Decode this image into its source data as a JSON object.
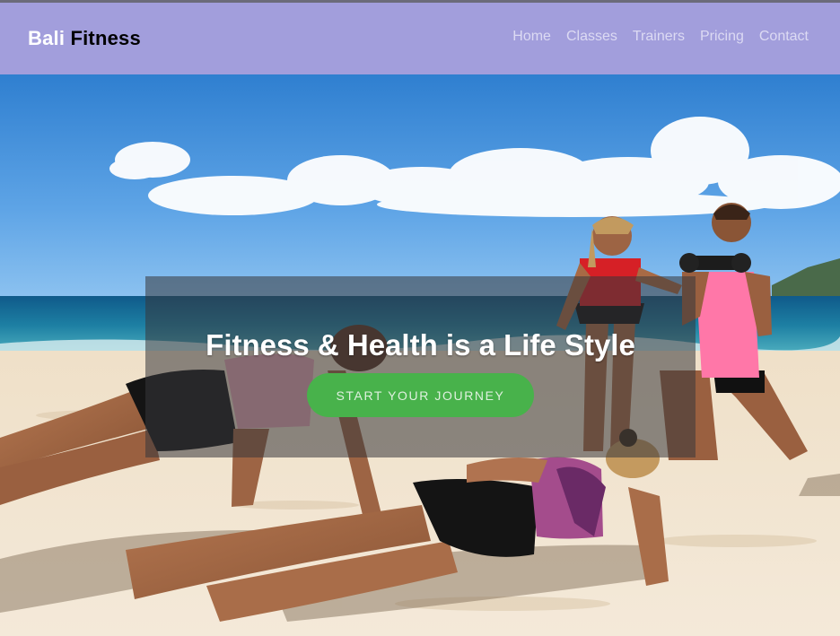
{
  "brand": {
    "part1": "Bali",
    "part2": "Fitness"
  },
  "nav": {
    "items": [
      "Home",
      "Classes",
      "Trainers",
      "Pricing",
      "Contact"
    ]
  },
  "hero": {
    "headline": "Fitness & Health is a Life Style",
    "cta_label": "START YOUR JOURNEY"
  },
  "colors": {
    "header_bg": "#a29edc",
    "nav_text": "#dcdaf3",
    "cta_bg": "#48b24b",
    "overlay": "rgba(55,55,58,0.55)"
  }
}
